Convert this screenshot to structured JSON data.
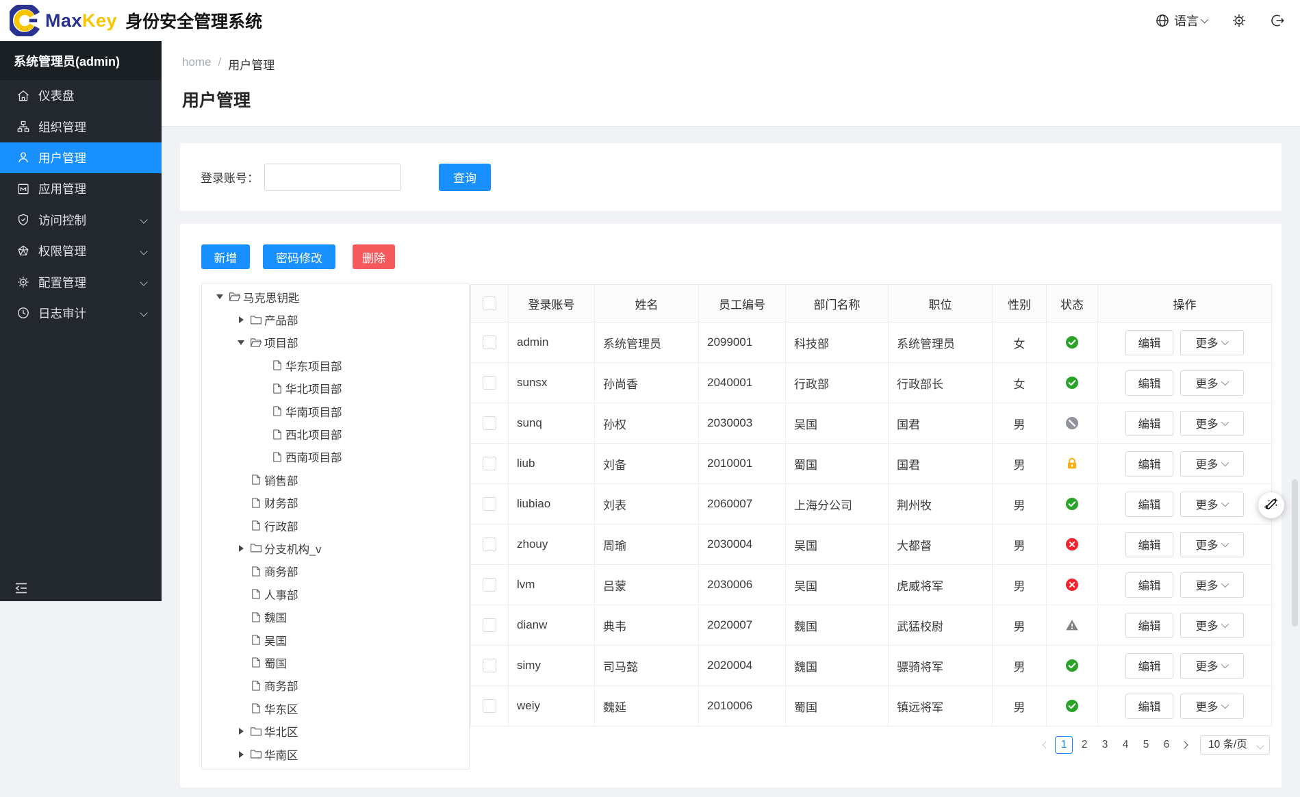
{
  "header": {
    "brand_max": "Max",
    "brand_key": "Key",
    "app_title": "身份安全管理系统",
    "language_label": "语言"
  },
  "sidebar": {
    "user": "系统管理员(admin)",
    "items": [
      {
        "label": "仪表盘",
        "icon": "dashboard-icon",
        "active": false,
        "has_children": false
      },
      {
        "label": "组织管理",
        "icon": "organization-icon",
        "active": false,
        "has_children": false
      },
      {
        "label": "用户管理",
        "icon": "user-icon",
        "active": true,
        "has_children": false
      },
      {
        "label": "应用管理",
        "icon": "application-icon",
        "active": false,
        "has_children": false
      },
      {
        "label": "访问控制",
        "icon": "shield-check-icon",
        "active": false,
        "has_children": true
      },
      {
        "label": "权限管理",
        "icon": "gem-icon",
        "active": false,
        "has_children": true
      },
      {
        "label": "配置管理",
        "icon": "gear-icon",
        "active": false,
        "has_children": true
      },
      {
        "label": "日志审计",
        "icon": "clock-icon",
        "active": false,
        "has_children": true
      }
    ]
  },
  "breadcrumb": {
    "home": "home",
    "separator": "/",
    "current": "用户管理"
  },
  "page": {
    "title": "用户管理"
  },
  "search": {
    "label": "登录账号：",
    "input_value": "",
    "query_button": "查询"
  },
  "toolbar": {
    "add": "新增",
    "change_password": "密码修改",
    "delete": "删除"
  },
  "tree": {
    "items": [
      {
        "level": 0,
        "caret": "down",
        "icon": "folder-open",
        "label": "马克思钥匙"
      },
      {
        "level": 1,
        "caret": "right",
        "icon": "folder-closed",
        "label": "产品部"
      },
      {
        "level": 1,
        "caret": "down",
        "icon": "folder-open",
        "label": "项目部"
      },
      {
        "level": 2,
        "caret": "",
        "icon": "file",
        "label": "华东项目部"
      },
      {
        "level": 2,
        "caret": "",
        "icon": "file",
        "label": "华北项目部"
      },
      {
        "level": 2,
        "caret": "",
        "icon": "file",
        "label": "华南项目部"
      },
      {
        "level": 2,
        "caret": "",
        "icon": "file",
        "label": "西北项目部"
      },
      {
        "level": 2,
        "caret": "",
        "icon": "file",
        "label": "西南项目部"
      },
      {
        "level": 1,
        "caret": "",
        "icon": "file",
        "label": "销售部"
      },
      {
        "level": 1,
        "caret": "",
        "icon": "file",
        "label": "财务部"
      },
      {
        "level": 1,
        "caret": "",
        "icon": "file",
        "label": "行政部"
      },
      {
        "level": 1,
        "caret": "right",
        "icon": "folder-closed",
        "label": "分支机构_v"
      },
      {
        "level": 1,
        "caret": "",
        "icon": "file",
        "label": "商务部"
      },
      {
        "level": 1,
        "caret": "",
        "icon": "file",
        "label": "人事部"
      },
      {
        "level": 1,
        "caret": "",
        "icon": "file",
        "label": "魏国"
      },
      {
        "level": 1,
        "caret": "",
        "icon": "file",
        "label": "吴国"
      },
      {
        "level": 1,
        "caret": "",
        "icon": "file",
        "label": "蜀国"
      },
      {
        "level": 1,
        "caret": "",
        "icon": "file",
        "label": "商务部"
      },
      {
        "level": 1,
        "caret": "",
        "icon": "file",
        "label": "华东区"
      },
      {
        "level": 1,
        "caret": "right",
        "icon": "folder-closed",
        "label": "华北区"
      },
      {
        "level": 1,
        "caret": "right",
        "icon": "folder-closed",
        "label": "华南区"
      }
    ]
  },
  "table": {
    "columns": [
      "登录账号",
      "姓名",
      "员工编号",
      "部门名称",
      "职位",
      "性别",
      "状态",
      "操作"
    ],
    "edit_button": "编辑",
    "more_button": "更多",
    "rows": [
      {
        "account": "admin",
        "name": "系统管理员",
        "employee_no": "2099001",
        "department": "科技部",
        "position": "系统管理员",
        "gender": "女",
        "status": "active"
      },
      {
        "account": "sunsx",
        "name": "孙尚香",
        "employee_no": "2040001",
        "department": "行政部",
        "position": "行政部长",
        "gender": "女",
        "status": "active"
      },
      {
        "account": "sunq",
        "name": "孙权",
        "employee_no": "2030003",
        "department": "吴国",
        "position": "国君",
        "gender": "男",
        "status": "disabled"
      },
      {
        "account": "liub",
        "name": "刘备",
        "employee_no": "2010001",
        "department": "蜀国",
        "position": "国君",
        "gender": "男",
        "status": "locked"
      },
      {
        "account": "liubiao",
        "name": "刘表",
        "employee_no": "2060007",
        "department": "上海分公司",
        "position": "荆州牧",
        "gender": "男",
        "status": "active"
      },
      {
        "account": "zhouy",
        "name": "周瑜",
        "employee_no": "2030004",
        "department": "吴国",
        "position": "大都督",
        "gender": "男",
        "status": "error"
      },
      {
        "account": "lvm",
        "name": "吕蒙",
        "employee_no": "2030006",
        "department": "吴国",
        "position": "虎威将军",
        "gender": "男",
        "status": "error"
      },
      {
        "account": "dianw",
        "name": "典韦",
        "employee_no": "2020007",
        "department": "魏国",
        "position": "武猛校尉",
        "gender": "男",
        "status": "warning"
      },
      {
        "account": "simy",
        "name": "司马懿",
        "employee_no": "2020004",
        "department": "魏国",
        "position": "骠骑将军",
        "gender": "男",
        "status": "active"
      },
      {
        "account": "weiy",
        "name": "魏延",
        "employee_no": "2010006",
        "department": "蜀国",
        "position": "镇远将军",
        "gender": "男",
        "status": "active"
      }
    ]
  },
  "pagination": {
    "pages": [
      "1",
      "2",
      "3",
      "4",
      "5",
      "6"
    ],
    "current": "1",
    "page_size": "10 条/页"
  },
  "colors": {
    "primary": "#1890ff",
    "danger": "#f5595c",
    "status_active": "#28a428",
    "status_error": "#f5222d",
    "status_locked": "#faad14",
    "status_disabled": "#909399",
    "status_warning": "#808080"
  }
}
